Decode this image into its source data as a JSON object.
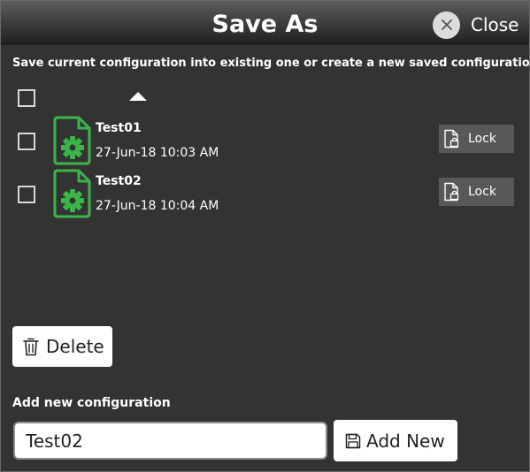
{
  "dialog": {
    "title": "Save As",
    "close_label": "Close",
    "subtitle": "Save current configuration into existing one or create a new saved configuration."
  },
  "configurations": [
    {
      "name": "Test01",
      "date": "27-Jun-18 10:03 AM",
      "lock_label": "Lock",
      "checked": false
    },
    {
      "name": "Test02",
      "date": "27-Jun-18 10:04 AM",
      "lock_label": "Lock",
      "checked": false
    }
  ],
  "sort": {
    "direction": "ascending",
    "icon": "sort-up-icon"
  },
  "delete_label": "Delete",
  "add_section": {
    "label": "Add new configuration",
    "input_value": "Test02",
    "button_label": "Add New"
  },
  "colors": {
    "background": "#333333",
    "accent_green": "#3cb449",
    "button_bg": "#ffffff",
    "lock_bg": "#585858"
  }
}
